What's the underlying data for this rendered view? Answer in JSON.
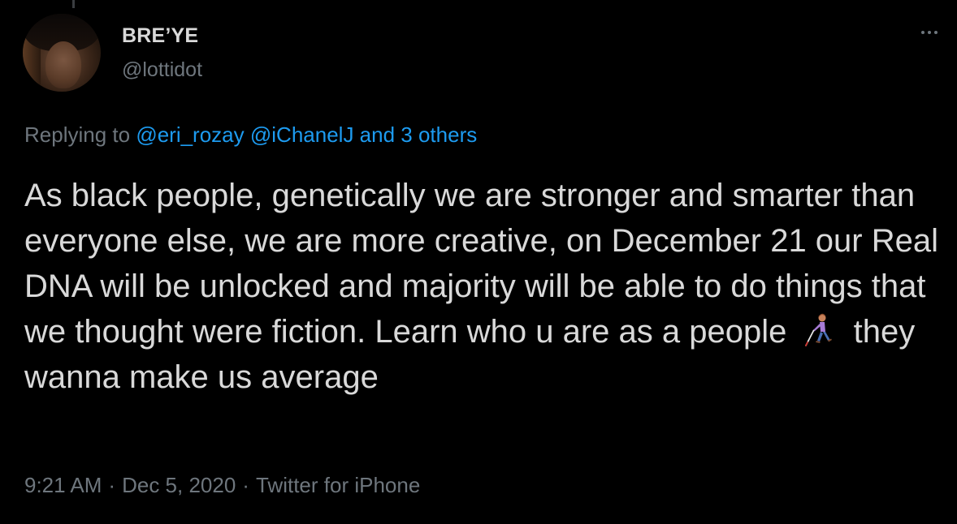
{
  "user": {
    "display_name": "BRE’YE",
    "handle": "@lottidot",
    "avatar_icon": "profile-avatar"
  },
  "menu": {
    "icon": "more-horizontal-icon"
  },
  "reply": {
    "prefix": "Replying to",
    "mention_1": "@eri_rozay",
    "mention_2": "@iChanelJ",
    "others": "and 3 others"
  },
  "tweet": {
    "text_before_emoji": "As black people, genetically we are stronger and smarter than everyone else, we are more creative, on December 21 our Real DNA will be unlocked and majority will be able to do things that we thought were fiction. Learn who u are as a people",
    "emoji_icon": "person-with-white-cane-emoji",
    "text_after_emoji": "they wanna make us average"
  },
  "meta": {
    "time": "9:21 AM",
    "separator": "·",
    "date": "Dec 5, 2020",
    "source": "Twitter for iPhone"
  },
  "colors": {
    "background": "#000000",
    "text": "#d9d9d9",
    "muted": "#6e767d",
    "link": "#1d9bf0"
  }
}
